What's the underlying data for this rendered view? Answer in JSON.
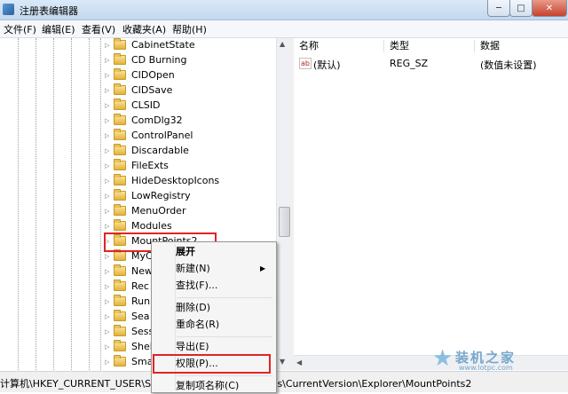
{
  "window": {
    "title": "注册表编辑器",
    "minimize": "─",
    "maximize": "□",
    "close": "✕"
  },
  "menubar": [
    "文件(F)",
    "编辑(E)",
    "查看(V)",
    "收藏夹(A)",
    "帮助(H)"
  ],
  "tree": {
    "items": [
      {
        "label": "CabinetState"
      },
      {
        "label": "CD Burning"
      },
      {
        "label": "CIDOpen"
      },
      {
        "label": "CIDSave"
      },
      {
        "label": "CLSID"
      },
      {
        "label": "ComDlg32"
      },
      {
        "label": "ControlPanel"
      },
      {
        "label": "Discardable"
      },
      {
        "label": "FileExts"
      },
      {
        "label": "HideDesktopIcons"
      },
      {
        "label": "LowRegistry"
      },
      {
        "label": "MenuOrder"
      },
      {
        "label": "Modules"
      },
      {
        "label": "MountPoints2"
      },
      {
        "label": "MyC"
      },
      {
        "label": "New"
      },
      {
        "label": "Rec"
      },
      {
        "label": "Run"
      },
      {
        "label": "Sea"
      },
      {
        "label": "Sess"
      },
      {
        "label": "Shel"
      },
      {
        "label": "Sma"
      }
    ],
    "selected": "MountPoints2"
  },
  "values_header": {
    "name": "名称",
    "type": "类型",
    "data": "数据"
  },
  "values": [
    {
      "icon": "ab",
      "name": "(默认)",
      "type": "REG_SZ",
      "data": "(数值未设置)"
    }
  ],
  "statusbar": {
    "path": "计算机\\HKEY_CURRENT_USER\\Software\\Microsoft\\Windows\\CurrentVersion\\Explorer\\MountPoints2"
  },
  "context_menu": {
    "items": [
      {
        "label": "展开",
        "bold": true
      },
      {
        "label": "新建(N)",
        "submenu": true
      },
      {
        "label": "查找(F)..."
      },
      {
        "label": "删除(D)"
      },
      {
        "label": "重命名(R)"
      },
      {
        "label": "导出(E)"
      },
      {
        "label": "权限(P)..."
      },
      {
        "label": "复制项名称(C)"
      }
    ],
    "highlighted": "权限(P)..."
  },
  "watermark": {
    "text": "装机之家",
    "url": "www.lotpc.com"
  }
}
